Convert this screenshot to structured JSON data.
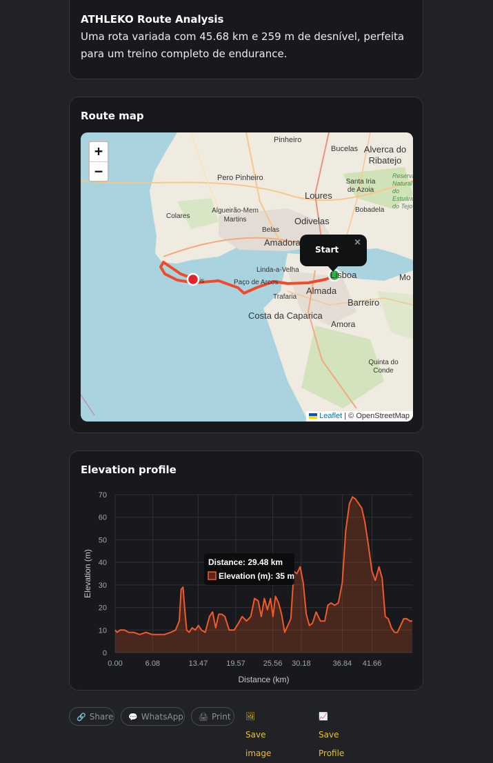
{
  "intro": {
    "title": "ATHLEKO Route Analysis",
    "description": "Uma rota variada com 45.68 km e 259 m de desnível, perfeita para um treino completo de endurance."
  },
  "map_card": {
    "title": "Route map",
    "zoom_in": "+",
    "zoom_out": "−",
    "popup_text": "Start",
    "popup_close": "×",
    "attribution_link": "Leaflet",
    "attribution_rest": "| © OpenStreetMap",
    "places": [
      "Pinheiro",
      "Bucelas",
      "Alverca do Ribatejo",
      "Pero Pinheiro",
      "Santa Iria de Azoia",
      "Loures",
      "Reserva Natural do Estuário do Tejo",
      "Bobadela",
      "Colares",
      "Algueirão-Mem Martins",
      "Odivelas",
      "Belas",
      "Amadora",
      "Linda-a-Velha",
      "Paço de Arcos",
      "Lisboa",
      "Mo",
      "Almada",
      "Trafaria",
      "Barreiro",
      "Costa da Caparica",
      "Amora",
      "Quinta do Conde",
      "is"
    ],
    "route_color": "#ef4a2c",
    "start_color": "#2fb34a",
    "end_color": "#e3232c"
  },
  "elevation_card": {
    "title": "Elevation profile",
    "tooltip_title": "Distance: 29.48 km",
    "tooltip_value": "Elevation (m): 35 m"
  },
  "chart_data": {
    "type": "area",
    "title": "",
    "xlabel": "Distance (km)",
    "ylabel": "Elevation (m)",
    "xlim": [
      0,
      48.2
    ],
    "ylim": [
      0,
      70
    ],
    "x_ticks": [
      "0.00",
      "6.08",
      "13.47",
      "19.57",
      "25.56",
      "30.18",
      "36.84",
      "41.66"
    ],
    "x_tick_values": [
      0,
      6.08,
      13.47,
      19.57,
      25.56,
      30.18,
      36.84,
      41.66
    ],
    "y_ticks": [
      0,
      10,
      20,
      30,
      40,
      50,
      60,
      70
    ],
    "series": [
      {
        "color": "#f25a2a",
        "x": [
          0,
          0.3,
          0.8,
          1.5,
          2.2,
          3.0,
          4.0,
          5.0,
          6.0,
          7.0,
          8.0,
          9.0,
          9.8,
          10.4,
          10.7,
          11.0,
          11.3,
          11.6,
          12.0,
          12.5,
          13.0,
          13.5,
          14.0,
          14.6,
          15.3,
          15.8,
          16.3,
          16.8,
          17.3,
          17.8,
          18.5,
          19.3,
          20.0,
          20.6,
          21.3,
          22.0,
          22.6,
          23.2,
          23.7,
          24.2,
          24.7,
          25.2,
          25.6,
          26.0,
          26.5,
          27.0,
          27.5,
          28.0,
          28.5,
          29.0,
          29.48,
          30.0,
          30.5,
          31.0,
          31.5,
          32.0,
          32.6,
          33.3,
          34.0,
          34.5,
          35.0,
          35.6,
          36.2,
          36.84,
          37.4,
          38.0,
          38.5,
          39.0,
          39.5,
          40.0,
          40.5,
          41.0,
          41.66,
          42.2,
          42.8,
          43.3,
          43.8,
          44.3,
          44.8,
          45.3,
          45.8,
          46.3,
          46.8,
          47.3,
          47.8,
          48.2
        ],
        "y": [
          10,
          9,
          10,
          10,
          9,
          9,
          8,
          9,
          8,
          8,
          8,
          9,
          10,
          14,
          28,
          29,
          19,
          10,
          9,
          11,
          10,
          12,
          10,
          9,
          16,
          18,
          11,
          17,
          17,
          16,
          10,
          10,
          13,
          16,
          14,
          16,
          24,
          23,
          16,
          24,
          19,
          24,
          16,
          25,
          22,
          17,
          9,
          12,
          15,
          36,
          35,
          38,
          31,
          17,
          12,
          13,
          18,
          14,
          14,
          21,
          22,
          21,
          22,
          31,
          54,
          66,
          69,
          68,
          66,
          64,
          58,
          49,
          36,
          32,
          38,
          33,
          16,
          15,
          11,
          9,
          9,
          12,
          15,
          15,
          14,
          14
        ]
      }
    ]
  },
  "actions": {
    "share": "Share",
    "whatsapp": "WhatsApp",
    "print": "Print",
    "save_image": "Save image",
    "save_profile": "Save Profile"
  }
}
